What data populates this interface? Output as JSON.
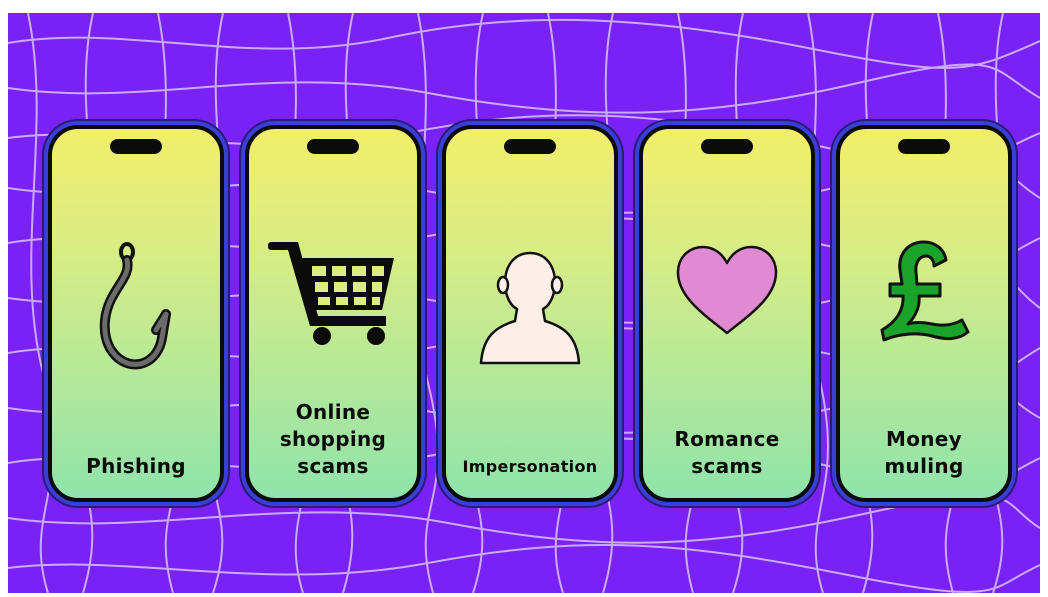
{
  "background_color": "#7a22f5",
  "screen_gradient": [
    "#f2ee6a",
    "#8fe3ac"
  ],
  "cards": [
    {
      "label": "Phishing",
      "icon": "fishing-hook-icon"
    },
    {
      "label": "Online\nshopping\nscams",
      "icon": "shopping-cart-icon"
    },
    {
      "label": "Impersonation",
      "icon": "person-silhouette-icon"
    },
    {
      "label": "Romance\nscams",
      "icon": "heart-icon"
    },
    {
      "label": "Money\nmuling",
      "icon": "pound-sign-icon"
    }
  ]
}
